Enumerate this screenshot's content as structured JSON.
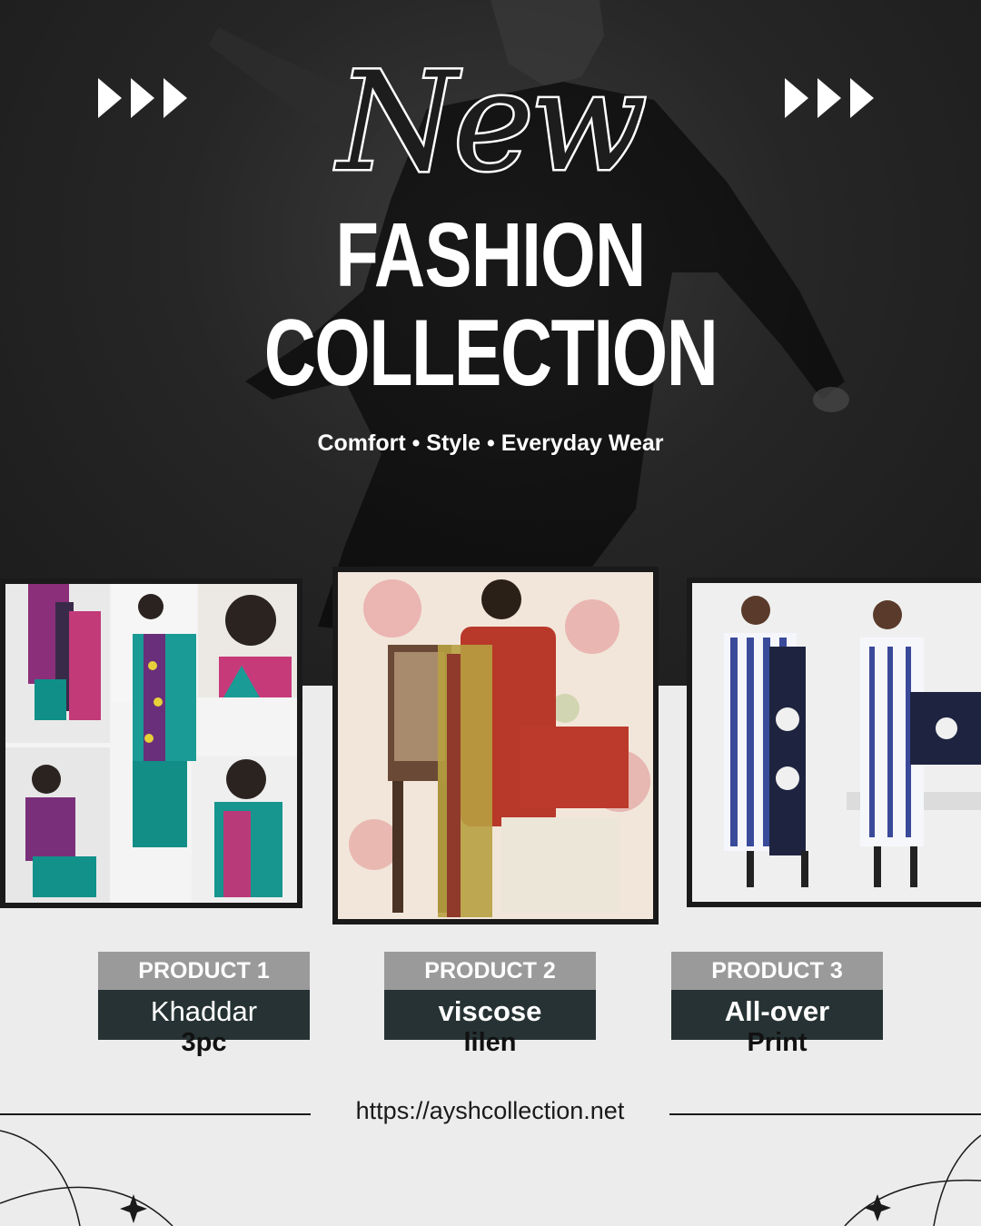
{
  "hero": {
    "script_title": "New",
    "title_line1": "FASHION",
    "title_line2": "COLLECTION",
    "tagline": "Comfort • Style • Everyday Wear"
  },
  "products": [
    {
      "label": "PRODUCT 1",
      "name": "Khaddar",
      "sub": "3pc"
    },
    {
      "label": "PRODUCT 2",
      "name": "viscose",
      "sub": "lilen"
    },
    {
      "label": "PRODUCT 3",
      "name": "All-over",
      "sub": "Print"
    }
  ],
  "footer": {
    "url": "https://ayshcollection.net"
  },
  "colors": {
    "hero_bg": "#262626",
    "label_head": "#9a9a9a",
    "label_body": "#263233",
    "page_bg": "#ececec"
  },
  "icons": [
    "triple-arrow-icon",
    "sparkle-icon"
  ]
}
